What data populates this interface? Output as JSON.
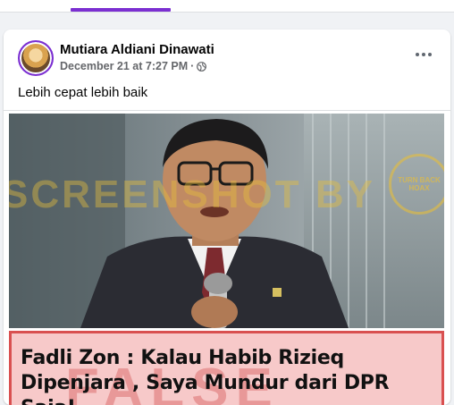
{
  "post": {
    "author": "Mutiara Aldiani Dinawati",
    "date": "December 21 at 7:27 PM",
    "separator": "·",
    "text": "Lebih cepat lebih baik",
    "privacy_icon": "globe-icon",
    "more_icon": "more-options-icon"
  },
  "image": {
    "watermark": "SCREENSHOT BY",
    "stamp": "TURN BACK HOAX",
    "caption_background_word": "FALSE",
    "caption": "Fadli Zon : Kalau Habib Rizieq Dipenjara , Saya Mundur dari DPR Saja!"
  },
  "colors": {
    "accent": "#7b2fd1",
    "caption_bg": "#f7c9c9",
    "caption_border": "#d95050",
    "watermark": "#e6be3c"
  }
}
